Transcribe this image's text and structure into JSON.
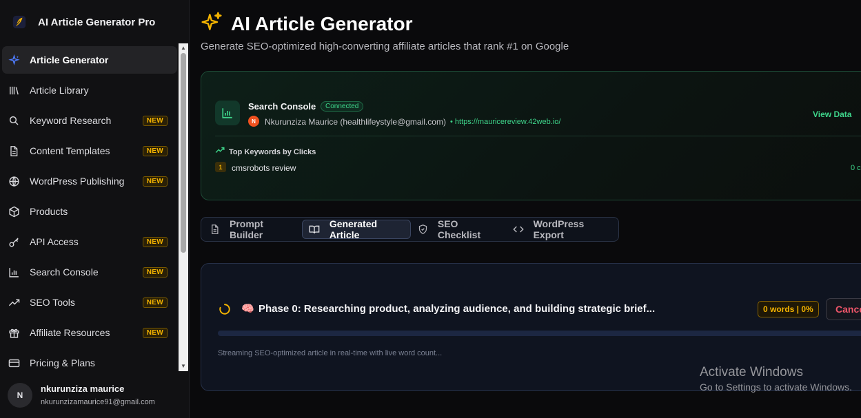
{
  "brand": {
    "title": "AI Article Generator Pro"
  },
  "sidebar": {
    "items": [
      {
        "label": "Article Generator",
        "icon": "sparkles-icon",
        "badge": "",
        "active": true
      },
      {
        "label": "Article Library",
        "icon": "library-icon",
        "badge": ""
      },
      {
        "label": "Keyword Research",
        "icon": "search-icon",
        "badge": "NEW"
      },
      {
        "label": "Content Templates",
        "icon": "file-text-icon",
        "badge": "NEW"
      },
      {
        "label": "WordPress Publishing",
        "icon": "globe-icon",
        "badge": "NEW"
      },
      {
        "label": "Products",
        "icon": "package-icon",
        "badge": ""
      },
      {
        "label": "API Access",
        "icon": "key-icon",
        "badge": "NEW"
      },
      {
        "label": "Search Console",
        "icon": "bar-chart-icon",
        "badge": "NEW"
      },
      {
        "label": "SEO Tools",
        "icon": "trending-up-icon",
        "badge": "NEW"
      },
      {
        "label": "Affiliate Resources",
        "icon": "gift-icon",
        "badge": "NEW"
      },
      {
        "label": "Pricing & Plans",
        "icon": "credit-card-icon",
        "badge": ""
      }
    ]
  },
  "user": {
    "initial": "N",
    "name": "nkurunziza maurice",
    "email": "nkurunzizamaurice91@gmail.com"
  },
  "page": {
    "title": "AI Article Generator",
    "subtitle": "Generate SEO-optimized high-converting affiliate articles that rank #1 on Google"
  },
  "search_console": {
    "title": "Search Console",
    "status": "Connected",
    "account_initial": "N",
    "account": "Nkurunziza Maurice (healthlifeystyle@gmail.com)",
    "site": "• https://mauricereview.42web.io/",
    "view_data": "View Data",
    "keywords_title": "Top Keywords by Clicks",
    "keywords": [
      {
        "rank": "1",
        "keyword": "cmsrobots review",
        "clicks": "0 c"
      }
    ]
  },
  "tabs": [
    {
      "label": "Prompt Builder",
      "icon": "file-icon",
      "active": false
    },
    {
      "label": "Generated Article",
      "icon": "book-open-icon",
      "active": true
    },
    {
      "label": "SEO Checklist",
      "icon": "shield-icon",
      "active": false
    },
    {
      "label": "WordPress Export",
      "icon": "code-icon",
      "active": false
    }
  ],
  "generation": {
    "emoji": "🧠",
    "phase": "Phase 0: Researching product, analyzing audience, and building strategic brief...",
    "word_badge": "0 words | 0%",
    "cancel": "Cancel",
    "progress": 0,
    "note": "Streaming SEO-optimized article in real-time with live word count..."
  },
  "watermark": {
    "title": "Activate Windows",
    "subtitle": "Go to Settings to activate Windows."
  },
  "colors": {
    "accent_green": "#3ed48a",
    "badge_yellow": "#f5b400",
    "cancel_red": "#f0566a",
    "progress_blue": "#3b82f6"
  }
}
